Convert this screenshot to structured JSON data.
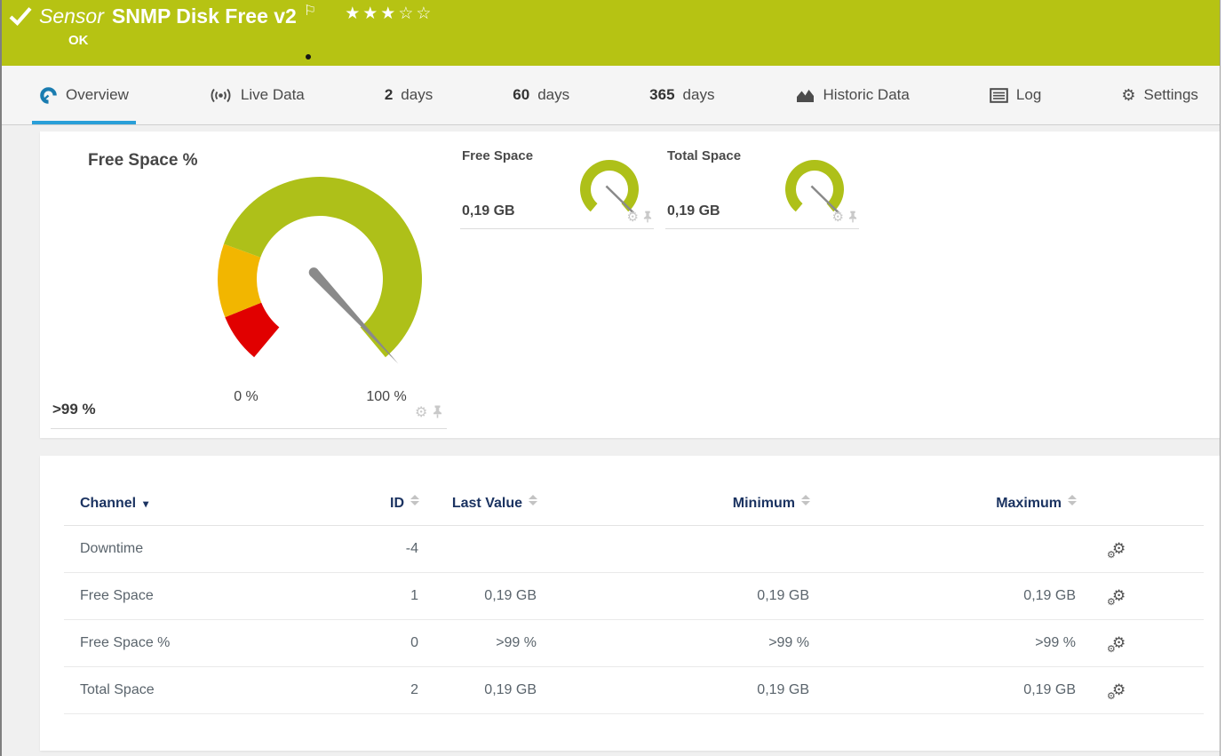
{
  "header": {
    "sensor_type_label": "Sensor",
    "sensor_name": "SNMP Disk Free v2",
    "status_text": "OK",
    "rating_filled": 3,
    "rating_total": 5
  },
  "tabs": [
    {
      "id": "overview",
      "label": "Overview",
      "icon": "gauge-icon",
      "active": true
    },
    {
      "id": "live-data",
      "label": "Live Data",
      "icon": "broadcast-icon",
      "active": false
    },
    {
      "id": "2-days",
      "number": "2",
      "label": "days",
      "active": false
    },
    {
      "id": "60-days",
      "number": "60",
      "label": "days",
      "active": false
    },
    {
      "id": "365-days",
      "number": "365",
      "label": "days",
      "active": false
    },
    {
      "id": "historic-data",
      "label": "Historic Data",
      "icon": "area-chart-icon",
      "active": false
    },
    {
      "id": "log",
      "label": "Log",
      "icon": "log-icon",
      "active": false
    },
    {
      "id": "settings",
      "label": "Settings",
      "icon": "gear-icon",
      "active": false
    }
  ],
  "gauge_panel": {
    "primary": {
      "title": "Free Space %",
      "value_label": ">99 %",
      "value_percent": 99,
      "scale_min_label": "0 %",
      "scale_max_label": "100 %",
      "sweep_deg": 280,
      "segments": [
        {
          "from": 0,
          "to": 10,
          "color": "#e10000"
        },
        {
          "from": 10,
          "to": 25,
          "color": "#f2b600"
        },
        {
          "from": 25,
          "to": 100,
          "color": "#aec019"
        }
      ],
      "needle_color": "#8a8a8a"
    },
    "mini": [
      {
        "title": "Free Space",
        "value_label": "0,19 GB",
        "value_percent": 98,
        "color": "#aec019"
      },
      {
        "title": "Total Space",
        "value_label": "0,19 GB",
        "value_percent": 98,
        "color": "#aec019"
      }
    ]
  },
  "channels_table": {
    "headers": {
      "channel": "Channel",
      "id": "ID",
      "last_value": "Last Value",
      "minimum": "Minimum",
      "maximum": "Maximum"
    },
    "rows": [
      {
        "channel": "Downtime",
        "id": "-4",
        "last_value": "",
        "minimum": "",
        "maximum": ""
      },
      {
        "channel": "Free Space",
        "id": "1",
        "last_value": "0,19 GB",
        "minimum": "0,19 GB",
        "maximum": "0,19 GB"
      },
      {
        "channel": "Free Space %",
        "id": "0",
        "last_value": ">99 %",
        "minimum": ">99 %",
        "maximum": ">99 %"
      },
      {
        "channel": "Total Space",
        "id": "2",
        "last_value": "0,19 GB",
        "minimum": "0,19 GB",
        "maximum": "0,19 GB"
      }
    ]
  },
  "icons": {
    "check": "✓",
    "flag": "⚐",
    "star_filled": "★",
    "star_empty": "☆",
    "gear": "⚙",
    "caret_down": "▾"
  },
  "colors": {
    "header_bg": "#b6c313",
    "active_tab_underline": "#2a9fd8",
    "table_header_text": "#1b3361",
    "gauge_green": "#aec019",
    "gauge_yellow": "#f2b600",
    "gauge_red": "#e10000",
    "needle_gray": "#8a8a8a"
  }
}
